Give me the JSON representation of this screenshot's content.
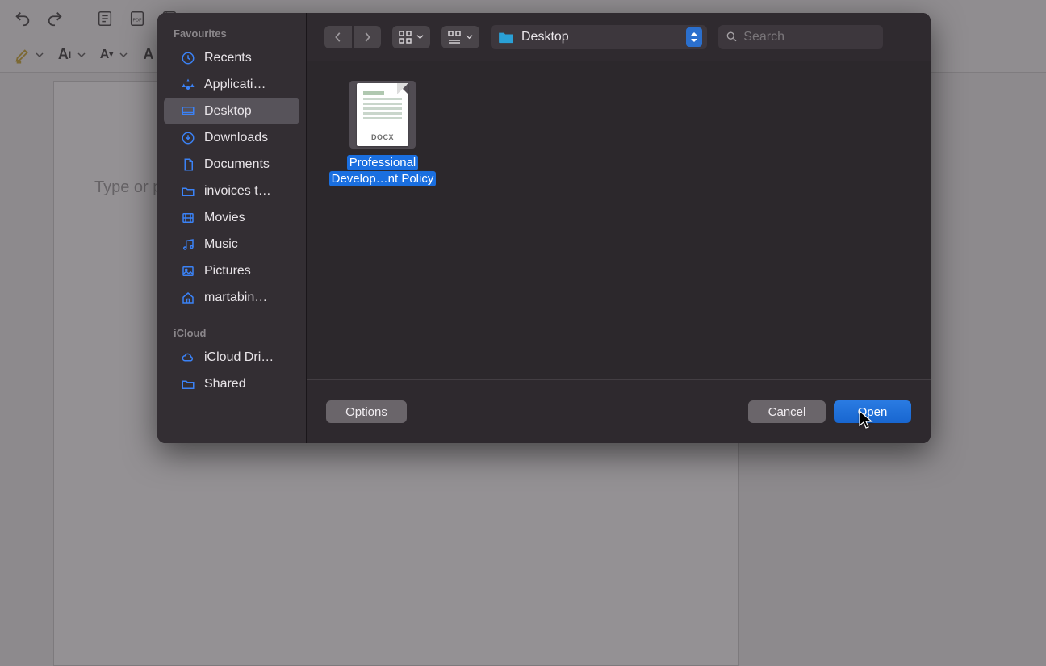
{
  "editor": {
    "placeholder_text": "Type or pa"
  },
  "dialog": {
    "location_label": "Desktop",
    "search_placeholder": "Search",
    "sidebar": {
      "sections": {
        "favourites": {
          "header": "Favourites",
          "items": [
            "Recents",
            "Applicati…",
            "Desktop",
            "Downloads",
            "Documents",
            "invoices t…",
            "Movies",
            "Music",
            "Pictures",
            "martabin…"
          ]
        },
        "icloud": {
          "header": "iCloud",
          "items": [
            "iCloud Dri…",
            "Shared"
          ]
        }
      },
      "selected": "Desktop"
    },
    "files": [
      {
        "badge": "DOCX",
        "label_line1": "Professional",
        "label_line2": "Develop…nt Policy"
      }
    ],
    "buttons": {
      "options": "Options",
      "cancel": "Cancel",
      "open": "Open"
    }
  }
}
